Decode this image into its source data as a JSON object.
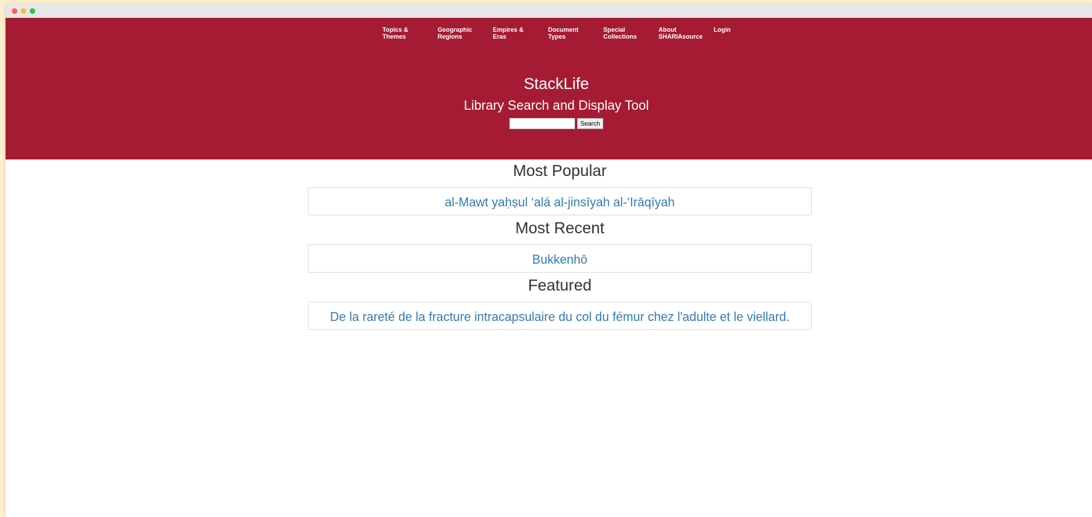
{
  "window": {
    "traffic_lights": [
      "close",
      "minimize",
      "zoom"
    ]
  },
  "nav": {
    "items": [
      {
        "line1": "Topics &",
        "line2": "Themes"
      },
      {
        "line1": "Geographic",
        "line2": "Regions"
      },
      {
        "line1": "Empires &",
        "line2": "Eras"
      },
      {
        "line1": "Document",
        "line2": "Types"
      },
      {
        "line1": "Special",
        "line2": "Collections"
      },
      {
        "line1": "About",
        "line2": "SHARIAsource"
      },
      {
        "line1": "Login",
        "line2": ""
      }
    ]
  },
  "hero": {
    "title": "StackLife",
    "subtitle": "Library Search and Display Tool",
    "search_value": "",
    "search_button": "Search"
  },
  "sections": [
    {
      "title": "Most Popular",
      "item": "al-Mawt yaḥṣul ‘alá al-jinsīyah al-‘Irāqīyah"
    },
    {
      "title": "Most Recent",
      "item": "Bukkenhō"
    },
    {
      "title": "Featured",
      "item": "De la rareté de la fracture intracapsulaire du col du fémur chez l'adulte et le viellard."
    }
  ],
  "colors": {
    "header_bg": "#a51b33",
    "link": "#337ab7",
    "heading": "#333333",
    "page_bg": "#fdf1cf"
  }
}
